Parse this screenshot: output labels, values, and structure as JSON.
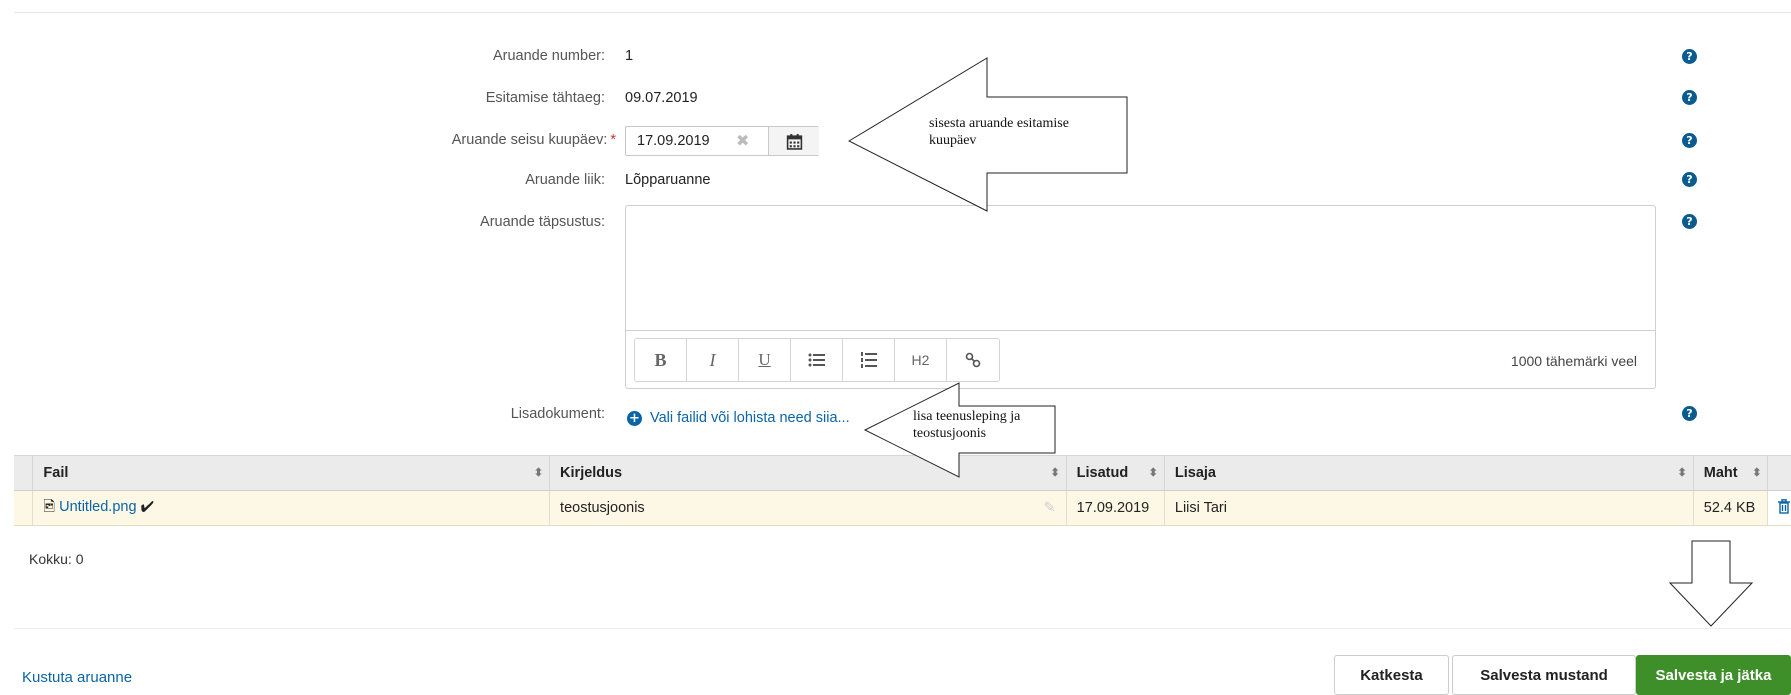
{
  "form": {
    "report_number_label": "Aruande number:",
    "report_number": "1",
    "due_date_label": "Esitamise tähtaeg:",
    "due_date": "09.07.2019",
    "state_date_label": "Aruande seisu kuupäev:",
    "required_mark": "*",
    "state_date": "17.09.2019",
    "report_type_label": "Aruande liik:",
    "report_type": "Lõpparuanne",
    "details_label": "Aruande täpsustus:",
    "editor": {
      "buttons": [
        "B",
        "I",
        "U",
        "bullet-list",
        "numbered-list",
        "H2",
        "link"
      ],
      "h2_label": "H2",
      "chars_remaining": "1000 tähemärki veel"
    },
    "attachment_label": "Lisadokument:",
    "upload_link": "Vali failid või lohista need siia..."
  },
  "help_icon": "?",
  "annotations": {
    "date_callout_line1": "sisesta aruande esitamise",
    "date_callout_line2": "kuupäev",
    "file_callout_line1": "lisa teenusleping ja",
    "file_callout_line2": "teostusjoonis"
  },
  "table": {
    "headers": {
      "file": "Fail",
      "description": "Kirjeldus",
      "added": "Lisatud",
      "adder": "Lisaja",
      "size": "Maht"
    },
    "rows": [
      {
        "file": "Untitled.png",
        "description": "teostusjoonis",
        "added": "17.09.2019",
        "adder": "Liisi Tari",
        "size": "52.4 KB"
      }
    ]
  },
  "total": "Kokku: 0",
  "footer": {
    "delete_link": "Kustuta aruanne",
    "cancel": "Katkesta",
    "save_draft": "Salvesta mustand",
    "save_continue": "Salvesta ja jätka"
  },
  "colors": {
    "link": "#0b64a6",
    "primary_button": "#3e8e2a",
    "row_highlight": "#fdf8e5",
    "help_icon": "#0a5b8f"
  }
}
